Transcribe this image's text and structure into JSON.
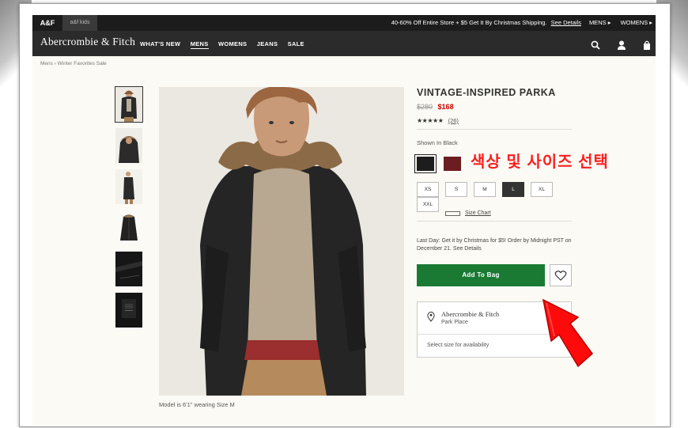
{
  "topbar": {
    "brand_tab": "A&F",
    "kids_tab": "a&f kids",
    "promo_text": "40-60% Off Entire Store + $5 Get It By Christmas Shipping.",
    "promo_link": "See Details",
    "mens": "MENS ▸",
    "womens": "WOMENS ▸"
  },
  "nav": {
    "logo": "Abercrombie & Fitch",
    "items": [
      "WHAT'S NEW",
      "MENS",
      "WOMENS",
      "JEANS",
      "SALE"
    ],
    "active": "MENS",
    "icons": [
      "search-icon",
      "account-icon",
      "bag-icon"
    ]
  },
  "breadcrumb": "Mens  ›  Winter Favorites Sale",
  "gallery": {
    "thumb_count": 6,
    "caption": "Model is 6'1\" wearing Size M"
  },
  "product": {
    "title": "VINTAGE-INSPIRED PARKA",
    "old_price": "$280",
    "new_price": "$168",
    "stars": "★★★★★",
    "rating_count": "(26)",
    "shown_in": "Shown In Black",
    "colors": [
      {
        "name": "Black",
        "hex": "#1d1d1d"
      },
      {
        "name": "Burgundy",
        "hex": "#6b1d22"
      }
    ],
    "annotation": "색상 및 사이즈 선택",
    "sizes": [
      "XS",
      "S",
      "M",
      "L",
      "XL",
      "XXL"
    ],
    "selected_size": "L",
    "size_chart": "Size Chart",
    "last_day": "Last Day: Get it by Christmas for $5! Order by Midnight PST on December 21. See Details",
    "add_to_bag": "Add To Bag",
    "store_name": "Abercrombie & Fitch",
    "store_location": "Park Place",
    "availability": "Select size for availability"
  },
  "colors": {
    "topbar_bg": "#1c1c1c",
    "nav_bg": "#2b2b2b",
    "add_button": "#1a7a34",
    "sale_price": "#cc0000",
    "annotation": "#ff1f1f"
  }
}
